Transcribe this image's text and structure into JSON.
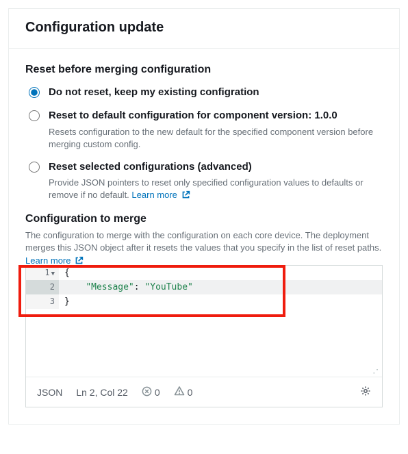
{
  "header": {
    "title": "Configuration update"
  },
  "resetSection": {
    "title": "Reset before merging configuration",
    "options": [
      {
        "id": "keep",
        "label": "Do not reset, keep my existing configration",
        "desc": null,
        "checked": true
      },
      {
        "id": "default",
        "label": "Reset to default configuration for component version: 1.0.0",
        "desc": "Resets configuration to the new default for the specified component version before merging custom config.",
        "checked": false
      },
      {
        "id": "selected",
        "label": "Reset selected configurations (advanced)",
        "desc": "Provide JSON pointers to reset only specified configuration values to defaults or remove if no default.",
        "learnMore": "Learn more",
        "checked": false
      }
    ]
  },
  "mergeSection": {
    "title": "Configuration to merge",
    "desc": "The configuration to merge with the configuration on each core device. The deployment merges this JSON object after it resets the values that you specify in the list of reset paths.",
    "learnMore": "Learn more"
  },
  "editor": {
    "lines": [
      {
        "n": "1",
        "fold": true,
        "content_parts": [
          [
            "brace",
            "{"
          ]
        ]
      },
      {
        "n": "2",
        "active": true,
        "content_parts": [
          [
            "indent",
            "    "
          ],
          [
            "key",
            "\"Message\""
          ],
          [
            "punc",
            ": "
          ],
          [
            "str",
            "\"YouTube\""
          ]
        ]
      },
      {
        "n": "3",
        "content_parts": [
          [
            "brace",
            "}"
          ]
        ]
      }
    ],
    "cursor_line": 2,
    "cursor_col": 22
  },
  "status": {
    "lang": "JSON",
    "pos": "Ln 2, Col 22",
    "errors": "0",
    "warnings": "0"
  },
  "chart_data": {
    "type": "table",
    "note": "JSON editor content",
    "json": {
      "Message": "YouTube"
    }
  }
}
